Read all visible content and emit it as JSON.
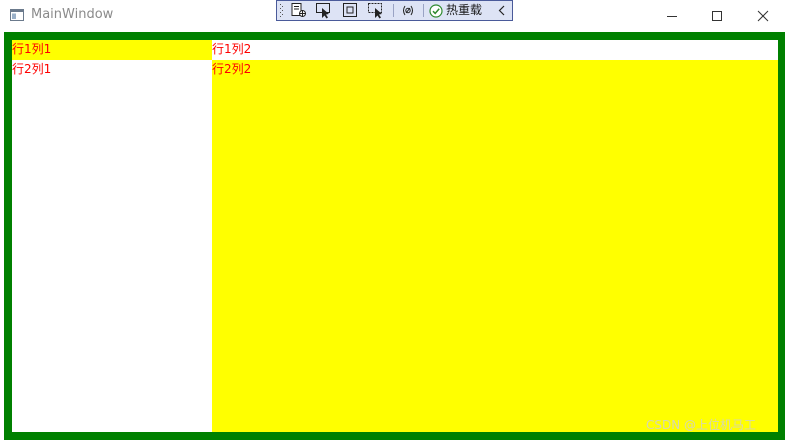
{
  "window": {
    "title": "MainWindow",
    "icon": "window-app-icon"
  },
  "caption_buttons": {
    "minimize": "minimize-icon",
    "maximize": "maximize-icon",
    "close": "close-icon"
  },
  "debug_toolbar": {
    "hot_reload_label": "热重载",
    "icons": [
      "live-visual-tree-icon",
      "select-element-icon",
      "display-layout-adorners-icon",
      "track-focused-element-icon",
      "binding-failures-icon",
      "hot-reload-check-icon",
      "collapse-chevron-icon"
    ]
  },
  "grid": {
    "cells": [
      {
        "row": 1,
        "col": 1,
        "text": "行1列1",
        "background": "#ffff00"
      },
      {
        "row": 1,
        "col": 2,
        "text": "行1列2",
        "background": "#ffffff"
      },
      {
        "row": 2,
        "col": 1,
        "text": "行2列1",
        "background": "#ffffff"
      },
      {
        "row": 2,
        "col": 2,
        "text": "行2列2",
        "background": "#ffff00"
      }
    ],
    "border_color": "#008000",
    "text_color": "#ff0000"
  },
  "watermark": "CSDN @上位机马工"
}
